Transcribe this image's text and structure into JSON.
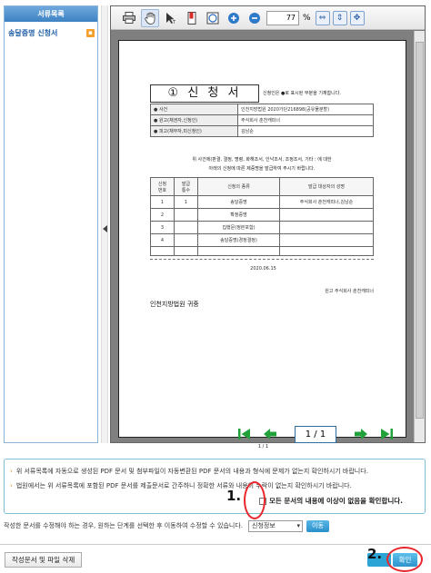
{
  "sidebar": {
    "title": "서류목록",
    "items": [
      {
        "label": "송달증명 신청서",
        "icon": "pdf-file-icon"
      }
    ]
  },
  "toolbar": {
    "buttons": [
      {
        "name": "print-icon"
      },
      {
        "name": "hand-tool-icon"
      },
      {
        "name": "select-cursor-icon"
      },
      {
        "name": "bookmark-icon"
      },
      {
        "name": "snapshot-icon"
      },
      {
        "name": "zoom-in-icon"
      },
      {
        "name": "zoom-out-icon"
      },
      {
        "name": "fit-width-icon"
      },
      {
        "name": "fit-height-icon"
      },
      {
        "name": "fit-page-icon"
      }
    ],
    "zoom_value": "77",
    "zoom_unit": "%"
  },
  "document": {
    "title": "① 신 청 서",
    "title_note": "신청인은 ●로 표시된 부분을 기재합니다.",
    "info_rows": [
      {
        "key": "● 사건",
        "value": "인천지방법원  2020가단216898(공유물분할)"
      },
      {
        "key": "● 원고(채권자,신청인)",
        "value": "주식회사 춘천캐피너"
      },
      {
        "key": "● 피고(채무자,피신청인)",
        "value": "김남순"
      }
    ],
    "intro_line1": "위 사건에(판결, 결정, 명령, 화해조서, 인낙조서, 조정조서, 기타 :                    에 대한",
    "intro_line2": "아래의 신청에 따른 제증명을 발급하여 주시기 바랍니다.",
    "table_headers": [
      "신청\n번호",
      "발급\n통수",
      "신청의 종류",
      "발급 대상자의 성명"
    ],
    "table_rows": [
      [
        "1",
        "1",
        "송달증명",
        "주식회사 춘천캐피너,김남순"
      ],
      [
        "2",
        "",
        "확정증명",
        ""
      ],
      [
        "3",
        "",
        "집행문(정본포함)",
        ""
      ],
      [
        "4",
        "",
        "송달증명(경정결정)",
        ""
      ]
    ],
    "date": "2020.06.15",
    "sender": "원고  주식회사 춘천캐피너",
    "court": "인천지방법원  귀중"
  },
  "pager": {
    "current": "1",
    "separator": "/",
    "total": "1",
    "status": "1 / 1"
  },
  "notices": [
    "위 서류목록에 자동으로 생성된 PDF 문서 및 첨부파일이 자동변환된 PDF 문서의 내용과 형식에 문제가 없는지 확인하시기 바랍니다.",
    "법원에서는 위 서류목록에 포함된 PDF 문서를 제출문서로 간주하니 정확한 서류와 내용이 누락이 없는지 확인하시기 바랍니다."
  ],
  "confirm": {
    "label": "모든 문서의 내용에 이상이 없음을 확인합니다.",
    "checked": false
  },
  "edit": {
    "text": "작성한 문서를 수정해야 하는 경우, 원하는 단계를 선택한 후 이동하여 수정할 수 있습니다.",
    "select_value": "신청정보",
    "move_label": "이동"
  },
  "footer": {
    "delete_label": "작성문서 및 파일 삭제",
    "ok_label": "확인"
  },
  "annotations": {
    "step1": "1.",
    "step2": "2."
  },
  "colors": {
    "header_blue": "#3d82c4",
    "accent_button": "#2d94cc",
    "annotation_red": "#e8262b",
    "bullet_orange": "#e48b1c"
  }
}
